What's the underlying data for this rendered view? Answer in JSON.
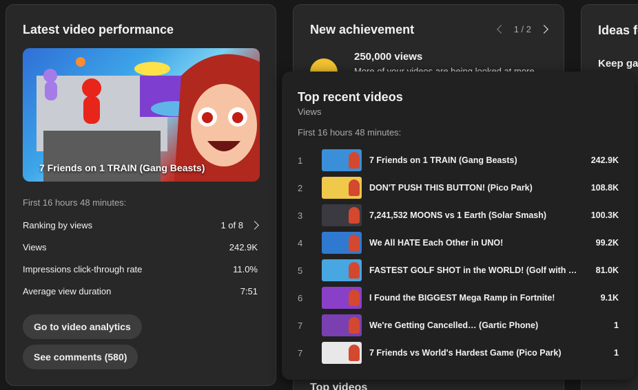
{
  "left_card": {
    "title": "Latest video performance",
    "thumbnail_caption": "7 Friends on 1 TRAIN (Gang Beasts)",
    "period": "First 16 hours 48 minutes:",
    "stats": [
      {
        "label": "Ranking by views",
        "value": "1 of 8"
      },
      {
        "label": "Views",
        "value": "242.9K"
      },
      {
        "label": "Impressions click-through rate",
        "value": "11.0%"
      },
      {
        "label": "Average view duration",
        "value": "7:51"
      }
    ],
    "buttons": {
      "analytics": "Go to video analytics",
      "comments": "See comments (580)"
    }
  },
  "mid_card": {
    "title": "New achievement",
    "pager": "1 / 2",
    "achievement_title": "250,000 views",
    "achievement_desc": "More of your videos are being looked at more",
    "bottom_heading": "Top videos"
  },
  "right_card": {
    "title": "Ideas fo",
    "subtitle": "Keep ga"
  },
  "popup": {
    "title": "Top recent videos",
    "metric": "Views",
    "period": "First 16 hours 48 minutes:",
    "videos": [
      {
        "rank": "1",
        "title": "7 Friends on 1 TRAIN (Gang Beasts)",
        "views": "242.9K",
        "thumb_color": "#3b8fd8"
      },
      {
        "rank": "2",
        "title": "DON'T PUSH THIS BUTTON! (Pico Park)",
        "views": "108.8K",
        "thumb_color": "#f0c84a"
      },
      {
        "rank": "3",
        "title": "7,241,532 MOONS vs 1 Earth (Solar Smash)",
        "views": "100.3K",
        "thumb_color": "#3a3a40"
      },
      {
        "rank": "4",
        "title": "We All HATE Each Other in UNO!",
        "views": "99.2K",
        "thumb_color": "#2f7ad0"
      },
      {
        "rank": "5",
        "title": "FASTEST GOLF SHOT in the WORLD! (Golf with Frie…",
        "views": "81.0K",
        "thumb_color": "#48a6e0"
      },
      {
        "rank": "6",
        "title": "I Found the BIGGEST Mega Ramp in Fortnite!",
        "views": "9.1K",
        "thumb_color": "#8a3fc8"
      },
      {
        "rank": "7",
        "title": "We're Getting Cancelled… (Gartic Phone)",
        "views": "1",
        "thumb_color": "#7a3fb0"
      },
      {
        "rank": "7",
        "title": "7 Friends vs World's Hardest Game (Pico Park)",
        "views": "1",
        "thumb_color": "#e8e8e8"
      }
    ]
  }
}
